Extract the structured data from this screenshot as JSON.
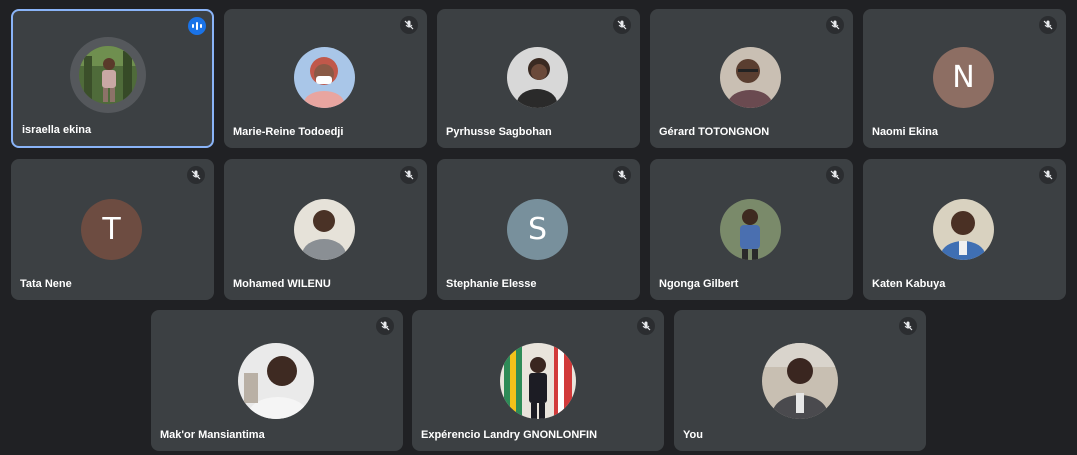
{
  "participants": [
    {
      "name": "israella ekina",
      "active": true,
      "avatar": "photo-outdoor-person-icon",
      "mic": "speaking-indicator-icon"
    },
    {
      "name": "Marie-Reine Todoedji",
      "avatar": "photo-masked-person-icon",
      "mic": "mic-off-icon"
    },
    {
      "name": "Pyrhusse Sagbohan",
      "avatar": "photo-person-icon",
      "mic": "mic-off-icon"
    },
    {
      "name": "Gérard TOTONGNON",
      "avatar": "photo-person-icon",
      "mic": "mic-off-icon"
    },
    {
      "name": "Naomi Ekina",
      "initial": "N",
      "color": "#8d6e63",
      "mic": "mic-off-icon"
    },
    {
      "name": "Tata Nene",
      "initial": "T",
      "color": "#6d4c41",
      "mic": "mic-off-icon"
    },
    {
      "name": "Mohamed WILENU",
      "avatar": "photo-person-icon",
      "mic": "mic-off-icon"
    },
    {
      "name": "Stephanie Elesse",
      "initial": "S",
      "color": "#78909c",
      "mic": "mic-off-icon"
    },
    {
      "name": "Ngonga Gilbert",
      "avatar": "photo-person-icon",
      "mic": "mic-off-icon"
    },
    {
      "name": "Katen Kabuya",
      "avatar": "photo-person-icon",
      "mic": "mic-off-icon"
    },
    {
      "name": "Mak'or Mansiantima",
      "avatar": "photo-person-icon",
      "mic": "mic-off-icon"
    },
    {
      "name": "Expérencio Landry GNONLONFIN",
      "avatar": "photo-person-flags-icon",
      "mic": "mic-off-icon"
    },
    {
      "name": "You",
      "avatar": "photo-person-icon",
      "mic": "mic-off-icon"
    }
  ],
  "colors": {
    "background": "#202124",
    "tile": "#3c4043",
    "active_border": "#8ab4f8",
    "speaking": "#1a73e8"
  }
}
